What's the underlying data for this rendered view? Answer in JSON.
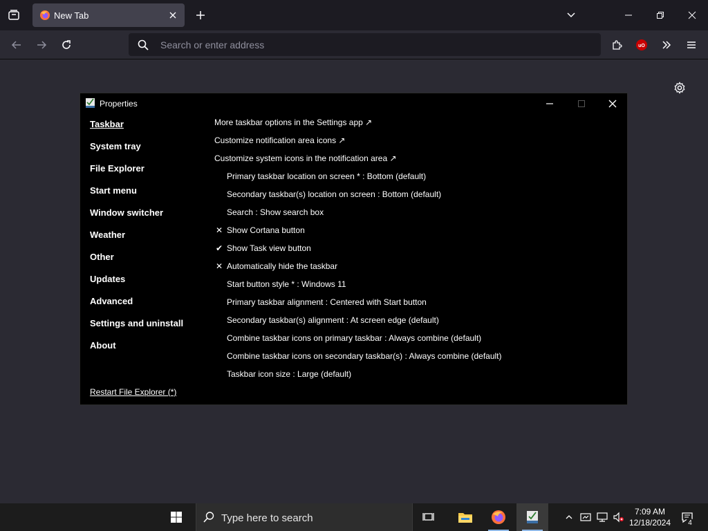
{
  "browser": {
    "tab": {
      "title": "New Tab"
    },
    "urlbar": {
      "placeholder": "Search or enter address"
    },
    "icons": [
      "tab-list-icon",
      "firefox-icon",
      "close-icon",
      "plus-icon",
      "chevron-down-icon",
      "minimize-icon",
      "restore-icon",
      "close-icon",
      "back-arrow-icon",
      "forward-arrow-icon",
      "reload-icon",
      "search-icon",
      "extensions-icon",
      "ublock-icon",
      "overflow-icon",
      "hamburger-menu-icon",
      "gear-icon"
    ],
    "ublock_color": "#c80000"
  },
  "properties": {
    "title": "Properties",
    "nav": [
      {
        "label": "Taskbar",
        "active": true
      },
      {
        "label": "System tray"
      },
      {
        "label": "File Explorer"
      },
      {
        "label": "Start menu"
      },
      {
        "label": "Window switcher"
      },
      {
        "label": "Weather"
      },
      {
        "label": "Other"
      },
      {
        "label": "Updates"
      },
      {
        "label": "Advanced"
      },
      {
        "label": "Settings and uninstall"
      },
      {
        "label": "About"
      }
    ],
    "restart_link": "Restart File Explorer (*)",
    "settings": [
      {
        "type": "link",
        "label": "More taskbar options in the Settings app ↗"
      },
      {
        "type": "link",
        "label": "Customize notification area icons ↗"
      },
      {
        "type": "link",
        "label": "Customize system icons in the notification area ↗"
      },
      {
        "type": "opt",
        "mark": "",
        "label": "Primary taskbar location on screen * : Bottom (default)"
      },
      {
        "type": "opt",
        "mark": "",
        "label": "Secondary taskbar(s) location on screen : Bottom (default)"
      },
      {
        "type": "opt",
        "mark": "",
        "label": "Search : Show search box"
      },
      {
        "type": "opt",
        "mark": "✕",
        "label": "Show Cortana button"
      },
      {
        "type": "opt",
        "mark": "✔",
        "label": "Show Task view button"
      },
      {
        "type": "opt",
        "mark": "✕",
        "label": "Automatically hide the taskbar"
      },
      {
        "type": "opt",
        "mark": "",
        "label": "Start button style * : Windows 11"
      },
      {
        "type": "opt",
        "mark": "",
        "label": "Primary taskbar alignment : Centered with Start button"
      },
      {
        "type": "opt",
        "mark": "",
        "label": "Secondary taskbar(s) alignment : At screen edge (default)"
      },
      {
        "type": "opt",
        "mark": "",
        "label": "Combine taskbar icons on primary taskbar : Always combine (default)"
      },
      {
        "type": "opt",
        "mark": "",
        "label": "Combine taskbar icons on secondary taskbar(s) : Always combine (default)"
      },
      {
        "type": "opt",
        "mark": "",
        "label": "Taskbar icon size : Large (default)"
      }
    ]
  },
  "taskbar": {
    "search_placeholder": "Type here to search",
    "time": "7:09 AM",
    "date": "12/18/2024",
    "notification_count": "4",
    "accent": "#8fb8e6"
  }
}
